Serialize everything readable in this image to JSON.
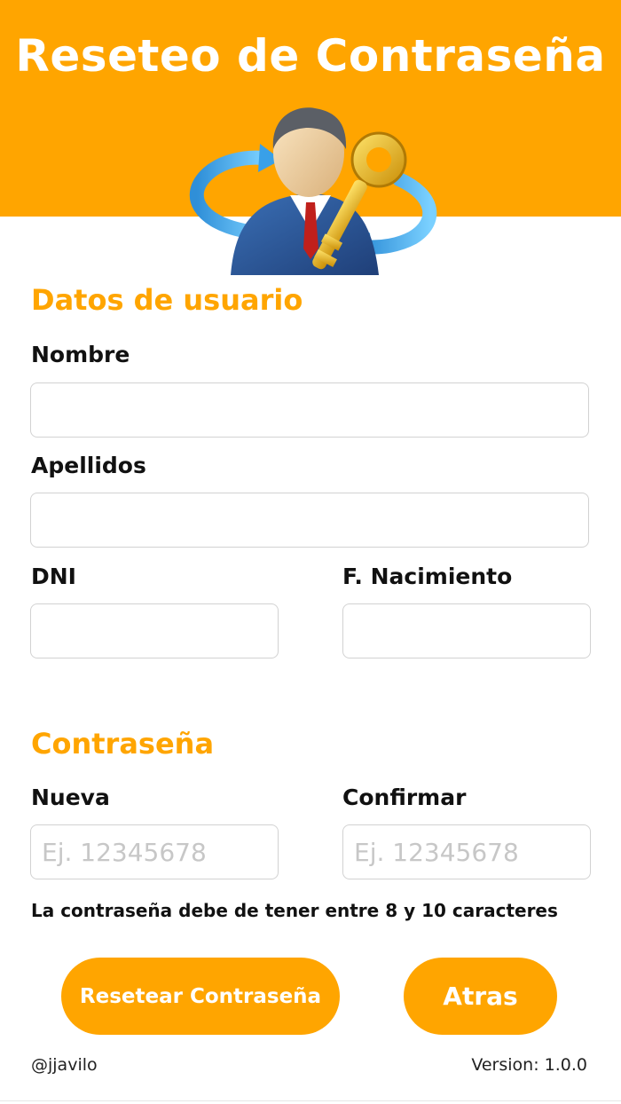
{
  "header": {
    "title": "Reseteo de Contraseña",
    "background_color": "#ffa500",
    "hero_icon": "user-key-reset-illustration"
  },
  "user_section": {
    "title": "Datos de usuario",
    "fields": {
      "nombre": {
        "label": "Nombre",
        "value": "",
        "placeholder": ""
      },
      "apellidos": {
        "label": "Apellidos",
        "value": "",
        "placeholder": ""
      },
      "dni": {
        "label": "DNI",
        "value": "",
        "placeholder": ""
      },
      "nacimiento": {
        "label": "F. Nacimiento",
        "value": "",
        "placeholder": ""
      }
    }
  },
  "password_section": {
    "title": "Contraseña",
    "fields": {
      "nueva": {
        "label": "Nueva",
        "value": "",
        "placeholder": "Ej. 12345678"
      },
      "confirmar": {
        "label": "Confirmar",
        "value": "",
        "placeholder": "Ej. 12345678"
      }
    },
    "hint": "La contraseña debe de tener entre 8 y 10 caracteres"
  },
  "actions": {
    "reset_label": "Resetear Contraseña",
    "back_label": "Atras"
  },
  "footer": {
    "author": "@jjavilo",
    "version": "Version: 1.0.0"
  },
  "colors": {
    "accent": "#ffa500",
    "text": "#111111",
    "input_border": "#d2d2d2"
  }
}
